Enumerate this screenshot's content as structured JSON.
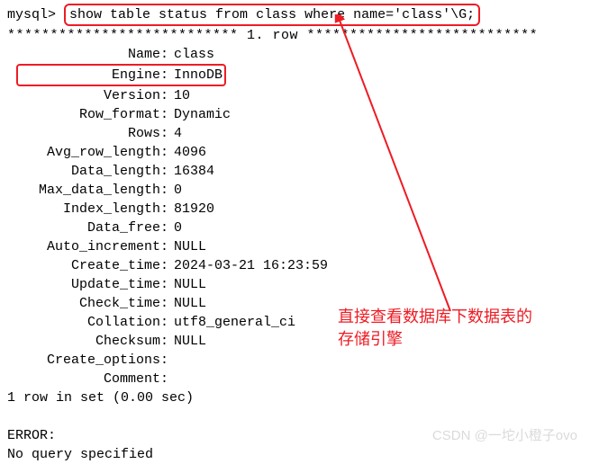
{
  "prompt": "mysql>",
  "command": "show table status from class where name='class'\\G;",
  "separator": "*************************** 1. row ***************************",
  "fields": [
    {
      "key": "Name",
      "value": "class"
    },
    {
      "key": "Engine",
      "value": "InnoDB",
      "highlight": true
    },
    {
      "key": "Version",
      "value": "10"
    },
    {
      "key": "Row_format",
      "value": "Dynamic"
    },
    {
      "key": "Rows",
      "value": "4"
    },
    {
      "key": "Avg_row_length",
      "value": "4096"
    },
    {
      "key": "Data_length",
      "value": "16384"
    },
    {
      "key": "Max_data_length",
      "value": "0"
    },
    {
      "key": "Index_length",
      "value": "81920"
    },
    {
      "key": "Data_free",
      "value": "0"
    },
    {
      "key": "Auto_increment",
      "value": "NULL"
    },
    {
      "key": "Create_time",
      "value": "2024-03-21 16:23:59"
    },
    {
      "key": "Update_time",
      "value": "NULL"
    },
    {
      "key": "Check_time",
      "value": "NULL"
    },
    {
      "key": "Collation",
      "value": "utf8_general_ci"
    },
    {
      "key": "Checksum",
      "value": "NULL"
    },
    {
      "key": "Create_options",
      "value": ""
    },
    {
      "key": "Comment",
      "value": ""
    }
  ],
  "footer": "1 row in set (0.00 sec)",
  "error_label": "ERROR:",
  "error_msg": "No query specified",
  "annotation_line1": "直接查看数据库下数据表的",
  "annotation_line2": "存储引擎",
  "watermark": "CSDN @一坨小橙子ovo"
}
